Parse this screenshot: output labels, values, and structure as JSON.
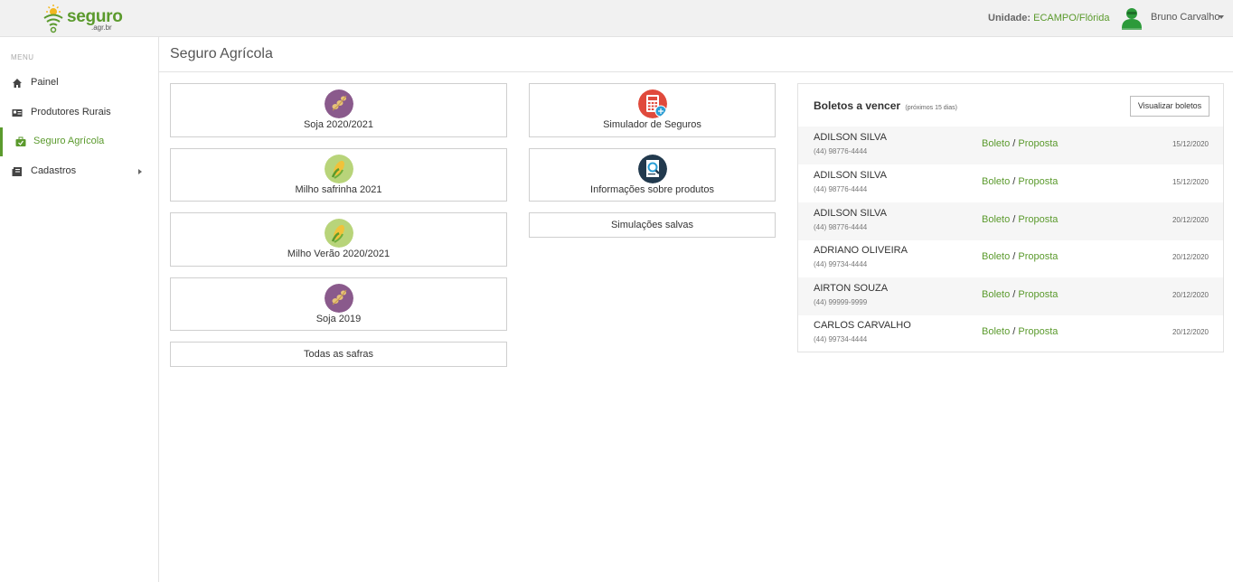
{
  "header": {
    "logo_text": "seguro",
    "logo_sub": ".agr.br",
    "unit_label": "Unidade:",
    "unit_value": "ECAMPO/Flórida",
    "user_name": "Bruno Carvalho",
    "accent_color": "#5b9a2d"
  },
  "sidebar": {
    "menu_title": "MENU",
    "items": [
      {
        "label": "Painel",
        "icon": "home-icon"
      },
      {
        "label": "Produtores Rurais",
        "icon": "id-card-icon"
      },
      {
        "label": "Seguro Agrícola",
        "icon": "briefcase-icon",
        "active": true
      },
      {
        "label": "Cadastros",
        "icon": "book-icon",
        "has_submenu": true
      }
    ]
  },
  "page": {
    "title": "Seguro Agrícola"
  },
  "cards_left": [
    {
      "label": "Soja 2020/2021",
      "icon": "soybean-icon"
    },
    {
      "label": "Milho safrinha 2021",
      "icon": "corn-icon"
    },
    {
      "label": "Milho Verão 2020/2021",
      "icon": "corn-icon"
    },
    {
      "label": "Soja 2019",
      "icon": "soybean-icon"
    },
    {
      "label": "Todas as safras"
    }
  ],
  "cards_right": [
    {
      "label": "Simulador de Seguros",
      "icon": "calculator-icon"
    },
    {
      "label": "Informações sobre produtos",
      "icon": "search-document-icon"
    },
    {
      "label": "Simulações salvas"
    }
  ],
  "boletos": {
    "title": "Boletos a vencer",
    "subtitle": "(próximos 15 dias)",
    "view_button": "Visualizar boletos",
    "link_boleto": "Boleto",
    "link_separator": "/",
    "link_proposta": "Proposta",
    "rows": [
      {
        "name": "ADILSON SILVA",
        "phone": "(44) 98776-4444",
        "date": "15/12/2020"
      },
      {
        "name": "ADILSON SILVA",
        "phone": "(44) 98776-4444",
        "date": "15/12/2020"
      },
      {
        "name": "ADILSON SILVA",
        "phone": "(44) 98776-4444",
        "date": "20/12/2020"
      },
      {
        "name": "ADRIANO OLIVEIRA",
        "phone": "(44) 99734-4444",
        "date": "20/12/2020"
      },
      {
        "name": "AIRTON SOUZA",
        "phone": "(44) 99999-9999",
        "date": "20/12/2020"
      },
      {
        "name": "CARLOS CARVALHO",
        "phone": "(44) 99734-4444",
        "date": "20/12/2020"
      }
    ]
  }
}
